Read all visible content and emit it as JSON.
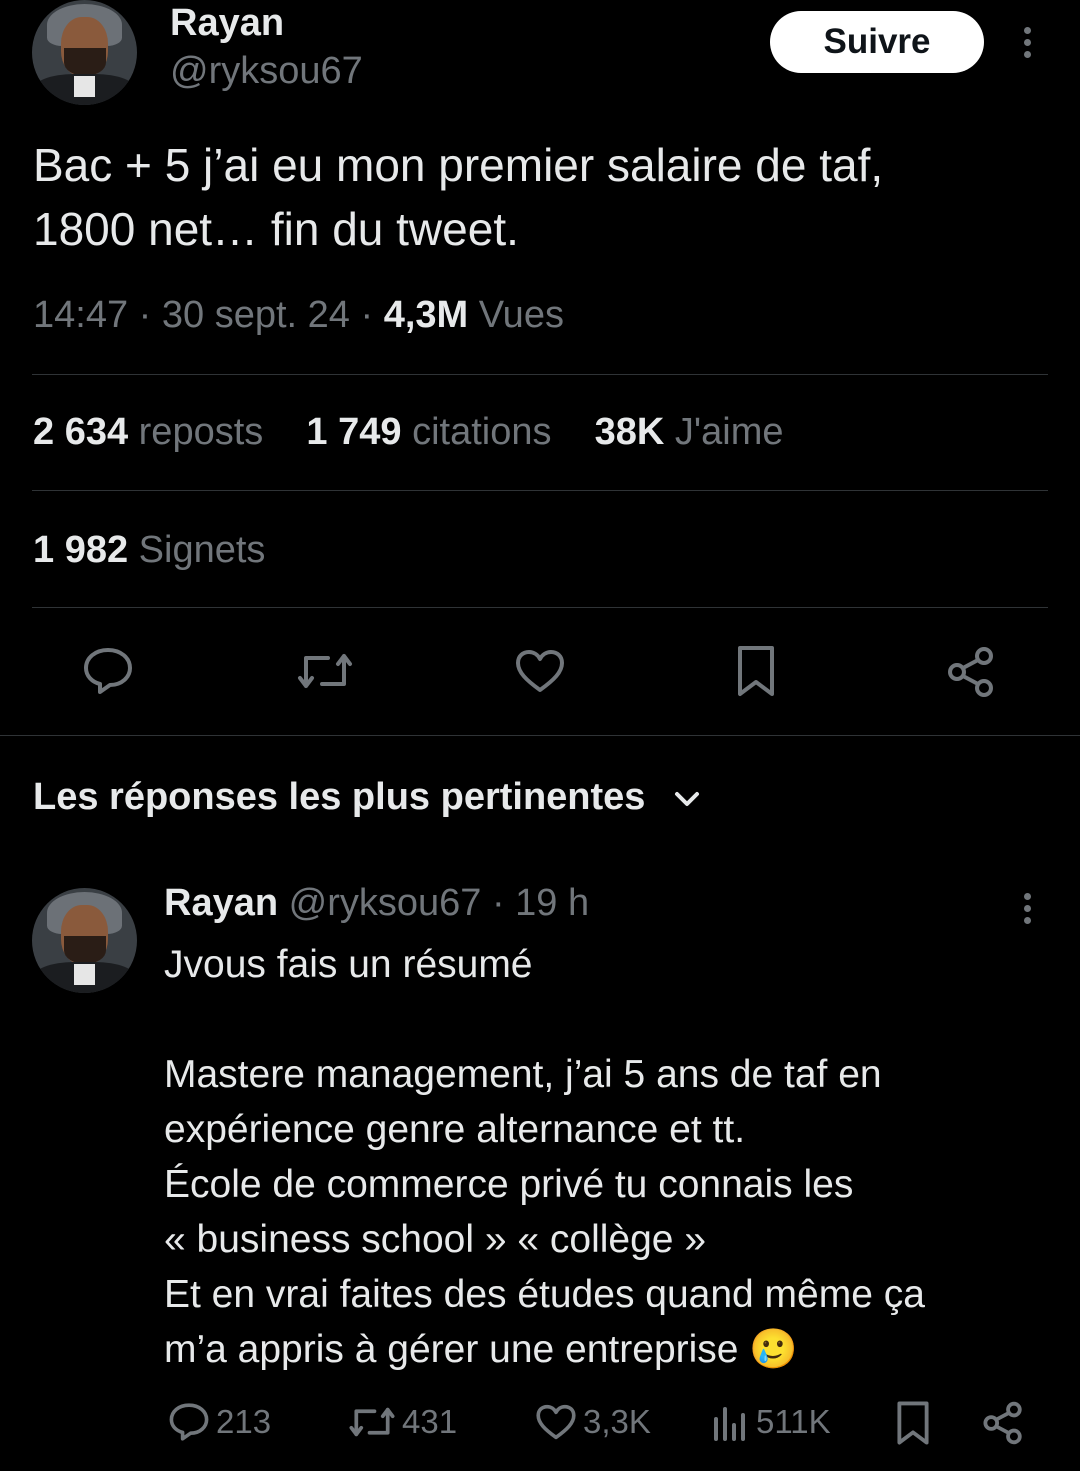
{
  "tweet": {
    "author_name": "Rayan",
    "author_handle": "@ryksou67",
    "follow_label": "Suivre",
    "text_line1": "Bac + 5 j’ai eu mon premier salaire de taf,",
    "text_line2": "1800 net… fin du tweet.",
    "time": "14:47",
    "date": "30 sept. 24",
    "views_count": "4,3M",
    "views_label": "Vues",
    "stats": {
      "reposts_count": "2 634",
      "reposts_label": "reposts",
      "quotes_count": "1 749",
      "quotes_label": "citations",
      "likes_count": "38K",
      "likes_label": "J'aime",
      "bookmarks_count": "1 982",
      "bookmarks_label": "Signets"
    }
  },
  "replies_header": {
    "label": "Les réponses les plus pertinentes"
  },
  "reply": {
    "author_name": "Rayan",
    "author_handle": "@ryksou67",
    "time_ago": "19 h",
    "line1": "Jvous fais un résumé",
    "line2": "Mastere management, j’ai 5 ans de taf en",
    "line3": "expérience genre alternance et tt.",
    "line4": "École de commerce privé tu connais les",
    "line5": "« business school » « collège »",
    "line6": "Et en vrai faites des études quand même ça",
    "line7": "m’a appris à gérer une entreprise",
    "emoji": "🥲",
    "reply_count": "213",
    "repost_count": "431",
    "like_count": "3,3K",
    "view_count": "511K"
  },
  "icons": {
    "reply": "reply-icon",
    "repost": "repost-icon",
    "like": "heart-icon",
    "bookmark": "bookmark-icon",
    "share": "share-icon",
    "views": "views-icon",
    "more": "more-icon",
    "chevron": "chevron-down-icon"
  },
  "colors": {
    "background": "#000000",
    "text": "#e7e9ea",
    "muted": "#71767b",
    "divider": "#2f3336"
  }
}
